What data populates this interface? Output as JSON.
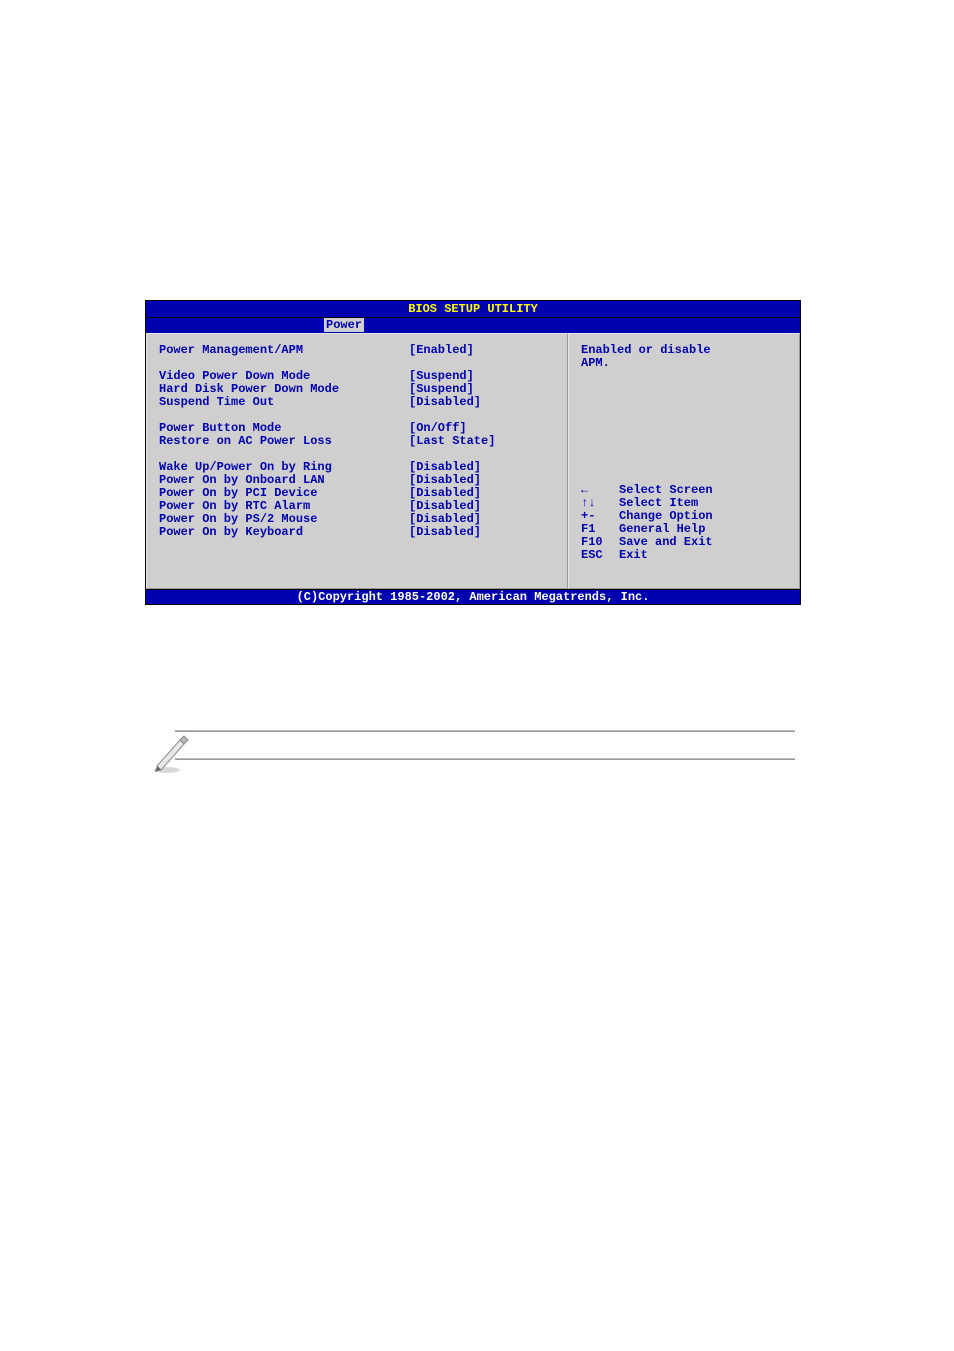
{
  "bios": {
    "title": "BIOS SETUP UTILITY",
    "tab": "Power",
    "rows": [
      {
        "label": "Power Management/APM",
        "value": "[Enabled]"
      },
      {
        "spacer": true
      },
      {
        "label": "Video Power Down Mode",
        "value": "[Suspend]"
      },
      {
        "label": "Hard Disk Power Down Mode",
        "value": "[Suspend]"
      },
      {
        "label": "Suspend Time Out",
        "value": "[Disabled]"
      },
      {
        "spacer": true
      },
      {
        "label": "Power Button Mode",
        "value": "[On/Off]"
      },
      {
        "label": "Restore on AC Power Loss",
        "value": "[Last State]"
      },
      {
        "spacer": true
      },
      {
        "label": "Wake Up/Power On by Ring",
        "value": "[Disabled]"
      },
      {
        "label": "Power On by Onboard LAN",
        "value": "[Disabled]"
      },
      {
        "label": "Power On by PCI Device",
        "value": "[Disabled]"
      },
      {
        "label": "Power On by RTC Alarm",
        "value": "[Disabled]"
      },
      {
        "label": "Power On by PS/2 Mouse",
        "value": "[Disabled]"
      },
      {
        "label": "Power On by Keyboard",
        "value": "[Disabled]"
      }
    ],
    "help_text_1": "Enabled or disable",
    "help_text_2": "APM.",
    "nav": [
      {
        "key": "←",
        "desc": "Select Screen"
      },
      {
        "key": "↑↓",
        "desc": "Select Item"
      },
      {
        "key": "+-",
        "desc": "Change Option"
      },
      {
        "key": "F1",
        "desc": "General Help"
      },
      {
        "key": "F10",
        "desc": "Save and Exit"
      },
      {
        "key": "ESC",
        "desc": "Exit"
      }
    ],
    "footer": "(C)Copyright 1985-2002, American Megatrends, Inc."
  }
}
